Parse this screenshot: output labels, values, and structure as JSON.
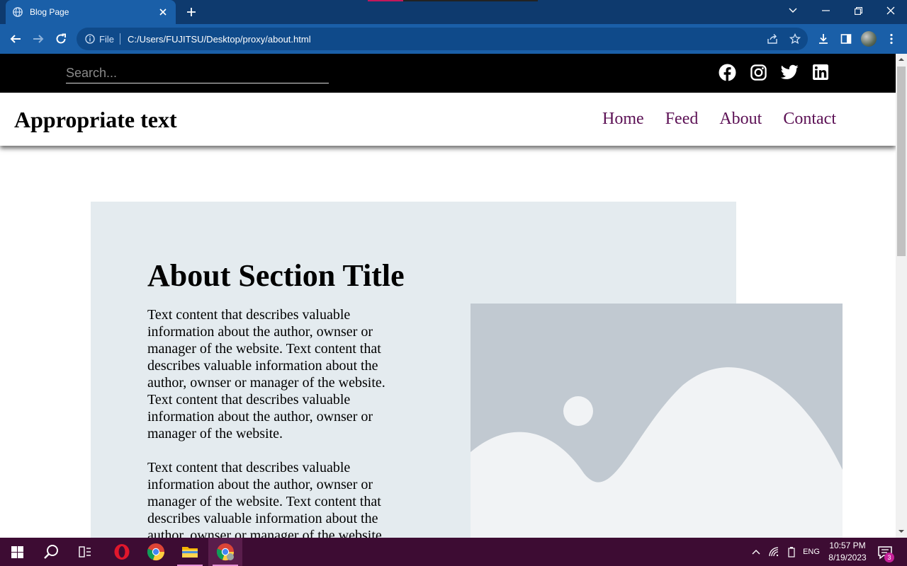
{
  "browser": {
    "tab_title": "Blog Page",
    "omnibox_label": "File",
    "url": "C:/Users/FUJITSU/Desktop/proxy/about.html",
    "accent": "#1a5fa8"
  },
  "site": {
    "search_placeholder": "Search...",
    "brand": "Appropriate text",
    "nav": [
      "Home",
      "Feed",
      "About",
      "Contact"
    ],
    "social_icons": [
      "facebook-icon",
      "instagram-icon",
      "twitter-icon",
      "linkedin-icon"
    ],
    "about": {
      "title": "About Section Title",
      "paragraphs": [
        "Text content that describes valuable information about the author, ownser or manager of the website. Text content that describes valuable information about the author, ownser or manager of the website. Text content that describes valuable information about the author, ownser or manager of the website.",
        "Text content that describes valuable information about the author, ownser or manager of the website. Text content that describes valuable information about the author, ownser or manager of the website."
      ]
    },
    "nav_color": "#5c1155",
    "box_color": "#e4ebef"
  },
  "taskbar": {
    "language": "ENG",
    "time": "10:57 PM",
    "date": "8/19/2023",
    "notification_count": "3"
  }
}
